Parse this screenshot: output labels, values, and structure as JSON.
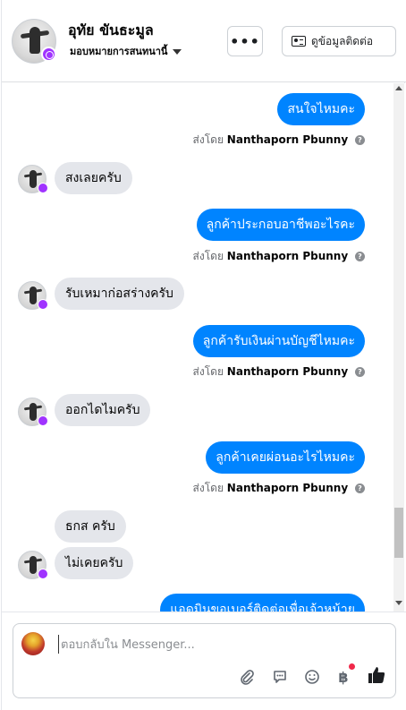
{
  "header": {
    "name": "อุทัย ขันธะมูล",
    "assign_label": "มอบหมายการสนทนานี้",
    "more_label": "•••",
    "contact_label": "ดูข้อมูลติดต่อ"
  },
  "messages": [
    {
      "dir": "out",
      "text": "สนใจไหมคะ"
    },
    {
      "dir": "meta",
      "prefix": "ส่งโดย",
      "sender": "Nanthaporn Pbunny"
    },
    {
      "dir": "in",
      "text": "สงเลยครับ"
    },
    {
      "dir": "out",
      "text": "ลูกค้าประกอบอาชีพอะไรคะ"
    },
    {
      "dir": "meta",
      "prefix": "ส่งโดย",
      "sender": "Nanthaporn Pbunny"
    },
    {
      "dir": "in",
      "text": "รับเหมาก่อสร่างครับ"
    },
    {
      "dir": "out",
      "text": "ลูกค้ารับเงินผ่านบัญชีไหมคะ"
    },
    {
      "dir": "meta",
      "prefix": "ส่งโดย",
      "sender": "Nanthaporn Pbunny"
    },
    {
      "dir": "in",
      "text": "ออกไดไมครับ"
    },
    {
      "dir": "out",
      "text": "ลูกค้าเคยผ่อนอะไรไหมคะ"
    },
    {
      "dir": "meta",
      "prefix": "ส่งโดย",
      "sender": "Nanthaporn Pbunny"
    },
    {
      "dir": "in",
      "text": "ธกส ครับ"
    },
    {
      "dir": "in",
      "text": "ไม่เคยครับ"
    },
    {
      "dir": "out",
      "text": "แอดมินขอเบอร์ติดต่อเพื่อเจ้าหน้าย"
    }
  ],
  "composer": {
    "placeholder": "ตอบกลับใน Messenger..."
  },
  "colors": {
    "outgoing": "#0084ff",
    "incoming": "#e4e6eb",
    "badge": "#a033ff"
  },
  "icons": [
    "more-icon",
    "contact-card-icon",
    "attach-icon",
    "saved-reply-icon",
    "emoji-icon",
    "baht-icon",
    "like-icon"
  ]
}
